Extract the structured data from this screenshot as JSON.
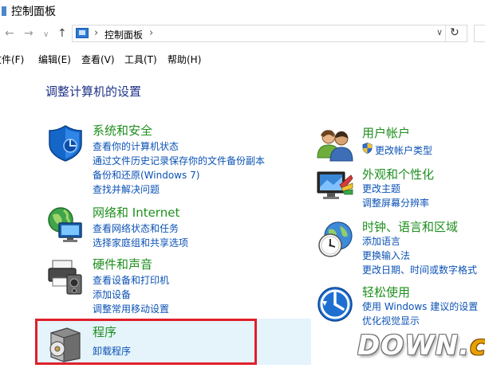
{
  "window": {
    "title": "控制面板"
  },
  "nav": {
    "back_glyph": "←",
    "forward_glyph": "→",
    "dropdown_glyph": "∨",
    "up_glyph": "↑",
    "address_sep": "›",
    "address_crumb": "控制面板",
    "address_dropdown": "∨",
    "refresh_glyph": "↻"
  },
  "menubar": {
    "file": "文件(F)",
    "edit": "编辑(E)",
    "view": "查看(V)",
    "tools": "工具(T)",
    "help": "帮助(H)"
  },
  "heading": "调整计算机的设置",
  "categories": {
    "system_security": {
      "title": "系统和安全",
      "links": [
        "查看你的计算机状态",
        "通过文件历史记录保存你的文件备份副本",
        "备份和还原(Windows 7)",
        "查找并解决问题"
      ]
    },
    "network": {
      "title": "网络和 Internet",
      "links": [
        "查看网络状态和任务",
        "选择家庭组和共享选项"
      ]
    },
    "hardware": {
      "title": "硬件和声音",
      "links": [
        "查看设备和打印机",
        "添加设备",
        "调整常用移动设置"
      ]
    },
    "programs": {
      "title": "程序",
      "links": [
        "卸载程序"
      ]
    },
    "user_accounts": {
      "title": "用户帐户",
      "links": [
        "更改帐户类型"
      ]
    },
    "appearance": {
      "title": "外观和个性化",
      "links": [
        "更改主题",
        "调整屏幕分辨率"
      ]
    },
    "clock_region": {
      "title": "时钟、语言和区域",
      "links": [
        "添加语言",
        "更换输入法",
        "更改日期、时间或数字格式"
      ]
    },
    "ease_access": {
      "title": "轻松使用",
      "links": [
        "使用 Windows 建议的设置",
        "优化视觉显示"
      ]
    }
  },
  "watermark": {
    "main": "DOWN.",
    "tld": "cc"
  },
  "colors": {
    "category_title": "#1e8f1e",
    "link": "#0b52b5",
    "heading": "#1e3287",
    "highlight_frame": "#e0202a"
  }
}
